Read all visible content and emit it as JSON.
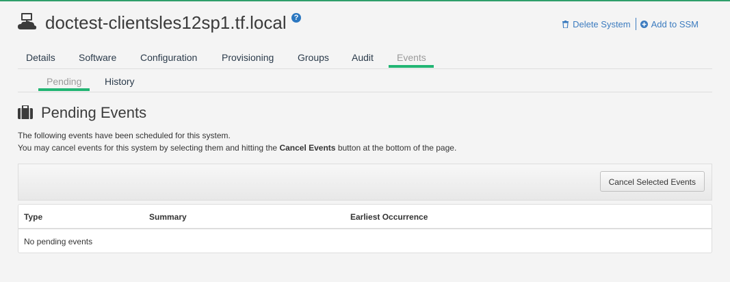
{
  "header": {
    "title": "doctest-clientsles12sp1.tf.local",
    "help_icon": "question-circle-icon",
    "actions": {
      "delete": "Delete System",
      "add_ssm": "Add to SSM"
    }
  },
  "tabs": [
    {
      "label": "Details"
    },
    {
      "label": "Software"
    },
    {
      "label": "Configuration"
    },
    {
      "label": "Provisioning"
    },
    {
      "label": "Groups"
    },
    {
      "label": "Audit"
    },
    {
      "label": "Events",
      "active": true
    }
  ],
  "subtabs": [
    {
      "label": "Pending",
      "active": true
    },
    {
      "label": "History"
    }
  ],
  "section": {
    "title": "Pending Events",
    "desc_line1": "The following events have been scheduled for this system.",
    "desc_line2_pre": "You may cancel events for this system by selecting them and hitting the ",
    "desc_line2_bold": "Cancel Events",
    "desc_line2_post": " button at the bottom of the page."
  },
  "toolbar": {
    "cancel_button": "Cancel Selected Events"
  },
  "table": {
    "columns": [
      "Type",
      "Summary",
      "Earliest Occurrence"
    ],
    "empty_message": "No pending events"
  },
  "colors": {
    "accent": "#22b573",
    "link": "#3b7bbf",
    "topbar": "#2e9e6a"
  }
}
